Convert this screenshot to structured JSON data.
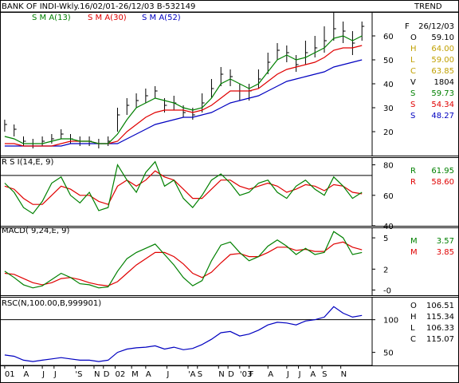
{
  "header": {
    "title": "BANK OF INDI-Wkly.16/02/01-26/12/03  B-532149",
    "trend_label": "TREND"
  },
  "colors": {
    "price": "#000000",
    "sma13": "#008000",
    "sma30": "#e00000",
    "sma52": "#0000c0",
    "panel_border": "#000000"
  },
  "chart_data": [
    {
      "type": "line",
      "panel": "price",
      "subtype": "ohlc-bars",
      "legend": [
        {
          "label": "S M A(13)",
          "color": "#008000"
        },
        {
          "label": "S M A(30)",
          "color": "#e00000"
        },
        {
          "label": "S M A(52)",
          "color": "#0000c0"
        }
      ],
      "ylim": [
        10,
        70
      ],
      "yticks": [
        "20",
        "30",
        "40",
        "50",
        "60"
      ],
      "ytick_values": [
        20,
        30,
        40,
        50,
        60
      ],
      "x": [
        0,
        4,
        8,
        12,
        16,
        20,
        24,
        28,
        32,
        36,
        40,
        44,
        48,
        52,
        56,
        60,
        64,
        68,
        72,
        76,
        80,
        84,
        88,
        92,
        96,
        100,
        104,
        108,
        112,
        116,
        120,
        124,
        128,
        132,
        136,
        140,
        144,
        148,
        152
      ],
      "close": [
        23,
        21,
        16,
        15,
        16,
        17,
        19,
        17,
        16,
        16,
        15,
        16,
        27,
        31,
        33,
        35,
        37,
        31,
        32,
        28,
        27,
        32,
        38,
        44,
        43,
        37,
        37,
        42,
        49,
        54,
        53,
        48,
        53,
        55,
        58,
        63,
        62,
        57,
        64
      ],
      "high": [
        25,
        23,
        18,
        17,
        18,
        19,
        21,
        19,
        18,
        18,
        17,
        18,
        30,
        34,
        36,
        38,
        39,
        34,
        35,
        31,
        30,
        36,
        42,
        47,
        46,
        40,
        40,
        46,
        53,
        57,
        56,
        52,
        58,
        60,
        64,
        70,
        66,
        62,
        66
      ],
      "low": [
        20,
        18,
        14,
        13,
        14,
        15,
        17,
        15,
        14,
        14,
        13,
        14,
        20,
        27,
        30,
        32,
        34,
        28,
        29,
        26,
        25,
        28,
        34,
        39,
        39,
        33,
        33,
        38,
        44,
        50,
        49,
        45,
        48,
        51,
        53,
        58,
        57,
        52,
        58
      ],
      "series": [
        {
          "name": "S M A(13)",
          "color": "#008000",
          "values": [
            18,
            17,
            15,
            15,
            15,
            16,
            17,
            17,
            16,
            16,
            15,
            15,
            19,
            25,
            30,
            32,
            34,
            33,
            32,
            30,
            29,
            30,
            34,
            40,
            42,
            40,
            38,
            40,
            45,
            50,
            52,
            50,
            51,
            53,
            55,
            59,
            60,
            58,
            60
          ]
        },
        {
          "name": "S M A(30)",
          "color": "#e00000",
          "values": [
            15,
            15,
            14,
            14,
            14,
            14,
            15,
            16,
            16,
            16,
            15,
            15,
            16,
            20,
            23,
            26,
            28,
            29,
            29,
            29,
            28,
            29,
            31,
            34,
            37,
            37,
            37,
            38,
            41,
            44,
            46,
            47,
            48,
            49,
            51,
            54,
            55,
            55,
            56
          ]
        },
        {
          "name": "S M A(52)",
          "color": "#0000c0",
          "values": [
            14,
            14,
            14,
            14,
            14,
            14,
            14,
            15,
            15,
            15,
            15,
            15,
            15,
            17,
            19,
            21,
            23,
            24,
            25,
            26,
            26,
            27,
            28,
            30,
            32,
            33,
            34,
            35,
            37,
            39,
            41,
            42,
            43,
            44,
            45,
            47,
            48,
            49,
            50
          ]
        }
      ],
      "info": [
        {
          "key": "F",
          "value": "26/12/03",
          "color": "#000000"
        },
        {
          "key": "O",
          "value": "59.10",
          "color": "#000000"
        },
        {
          "key": "H",
          "value": "64.00",
          "color": "#c0a000"
        },
        {
          "key": "L",
          "value": "59.00",
          "color": "#c0a000"
        },
        {
          "key": "C",
          "value": "63.85",
          "color": "#c0a000"
        },
        {
          "key": "V",
          "value": "1804",
          "color": "#000000"
        },
        {
          "key": "S",
          "value": "59.73",
          "color": "#008000"
        },
        {
          "key": "S",
          "value": "54.34",
          "color": "#e00000"
        },
        {
          "key": "S",
          "value": "48.27",
          "color": "#0000c0"
        }
      ]
    },
    {
      "type": "line",
      "panel": "rsi",
      "title": "R S I(14,E, 9)",
      "ylim": [
        40,
        85
      ],
      "yticks": [
        "80",
        "60",
        "40"
      ],
      "ytick_values": [
        80,
        60,
        40
      ],
      "reference_line": 73,
      "x": [
        0,
        4,
        8,
        12,
        16,
        20,
        24,
        28,
        32,
        36,
        40,
        44,
        48,
        52,
        56,
        60,
        64,
        68,
        72,
        76,
        80,
        84,
        88,
        92,
        96,
        100,
        104,
        108,
        112,
        116,
        120,
        124,
        128,
        132,
        136,
        140,
        144,
        148,
        152
      ],
      "series": [
        {
          "name": "R",
          "color": "#008000",
          "values": [
            68,
            62,
            52,
            48,
            56,
            68,
            72,
            60,
            55,
            62,
            50,
            52,
            80,
            70,
            62,
            75,
            82,
            66,
            70,
            58,
            52,
            60,
            70,
            74,
            68,
            60,
            62,
            68,
            70,
            62,
            58,
            66,
            70,
            64,
            60,
            72,
            66,
            58,
            62
          ]
        },
        {
          "name": "R",
          "color": "#e00000",
          "values": [
            66,
            64,
            58,
            54,
            54,
            60,
            66,
            64,
            60,
            60,
            56,
            54,
            66,
            70,
            66,
            70,
            76,
            72,
            70,
            64,
            58,
            58,
            64,
            70,
            70,
            66,
            64,
            66,
            68,
            66,
            62,
            64,
            67,
            66,
            63,
            67,
            66,
            62,
            61
          ]
        }
      ],
      "info": [
        {
          "key": "R",
          "value": "61.95",
          "color": "#008000"
        },
        {
          "key": "R",
          "value": "58.60",
          "color": "#e00000"
        }
      ]
    },
    {
      "type": "line",
      "panel": "macd",
      "title": "MACD( 9,24,E, 9)",
      "ylim": [
        -0.5,
        6
      ],
      "yticks": [
        "5",
        "2",
        "-0"
      ],
      "ytick_values": [
        5,
        2,
        0
      ],
      "x": [
        0,
        4,
        8,
        12,
        16,
        20,
        24,
        28,
        32,
        36,
        40,
        44,
        48,
        52,
        56,
        60,
        64,
        68,
        72,
        76,
        80,
        84,
        88,
        92,
        96,
        100,
        104,
        108,
        112,
        116,
        120,
        124,
        128,
        132,
        136,
        140,
        144,
        148,
        152
      ],
      "series": [
        {
          "name": "M",
          "color": "#008000",
          "values": [
            1.8,
            1.2,
            0.5,
            0.2,
            0.4,
            1.0,
            1.6,
            1.2,
            0.6,
            0.5,
            0.2,
            0.3,
            1.8,
            3.0,
            3.6,
            4.0,
            4.4,
            3.4,
            2.4,
            1.2,
            0.4,
            0.9,
            2.8,
            4.3,
            4.6,
            3.6,
            2.8,
            3.2,
            4.2,
            4.8,
            4.2,
            3.4,
            4.0,
            3.4,
            3.6,
            5.6,
            5.0,
            3.4,
            3.6
          ]
        },
        {
          "name": "M",
          "color": "#e00000",
          "values": [
            1.6,
            1.5,
            1.1,
            0.7,
            0.5,
            0.7,
            1.1,
            1.2,
            1.0,
            0.7,
            0.5,
            0.4,
            0.8,
            1.6,
            2.4,
            3.0,
            3.6,
            3.6,
            3.2,
            2.5,
            1.6,
            1.2,
            1.7,
            2.6,
            3.4,
            3.5,
            3.2,
            3.2,
            3.6,
            4.1,
            4.1,
            3.8,
            3.9,
            3.7,
            3.7,
            4.4,
            4.6,
            4.1,
            3.85
          ]
        }
      ],
      "info": [
        {
          "key": "M",
          "value": "3.57",
          "color": "#008000"
        },
        {
          "key": "M",
          "value": "3.85",
          "color": "#e00000"
        }
      ]
    },
    {
      "type": "line",
      "panel": "rsc",
      "title": "RSC(N,100.00,B,999901)",
      "ylim": [
        30,
        135
      ],
      "yticks": [
        "100",
        "50"
      ],
      "ytick_values": [
        100,
        50
      ],
      "reference_line": 100,
      "x": [
        0,
        4,
        8,
        12,
        16,
        20,
        24,
        28,
        32,
        36,
        40,
        44,
        48,
        52,
        56,
        60,
        64,
        68,
        72,
        76,
        80,
        84,
        88,
        92,
        96,
        100,
        104,
        108,
        112,
        116,
        120,
        124,
        128,
        132,
        136,
        140,
        144,
        148,
        152
      ],
      "series": [
        {
          "name": "RSC",
          "color": "#0000c0",
          "values": [
            46,
            44,
            38,
            36,
            38,
            40,
            42,
            40,
            38,
            38,
            36,
            38,
            50,
            55,
            57,
            58,
            60,
            55,
            58,
            54,
            56,
            62,
            70,
            80,
            82,
            75,
            78,
            84,
            92,
            96,
            95,
            92,
            98,
            100,
            104,
            120,
            110,
            104,
            106.5
          ]
        }
      ],
      "info": [
        {
          "key": "O",
          "value": "106.51",
          "color": "#000000"
        },
        {
          "key": "H",
          "value": "115.34",
          "color": "#000000"
        },
        {
          "key": "L",
          "value": "106.33",
          "color": "#000000"
        },
        {
          "key": "C",
          "value": "115.07",
          "color": "#000000"
        }
      ]
    }
  ],
  "xaxis": {
    "xlim": [
      -2,
      156
    ],
    "ticks": [
      {
        "label": "01",
        "x": 0
      },
      {
        "label": "A",
        "x": 8
      },
      {
        "label": "J",
        "x": 16
      },
      {
        "label": "J",
        "x": 21
      },
      {
        "label": "'S",
        "x": 30
      },
      {
        "label": "N",
        "x": 38
      },
      {
        "label": "D",
        "x": 42
      },
      {
        "label": "02",
        "x": 47
      },
      {
        "label": "M",
        "x": 54
      },
      {
        "label": "A",
        "x": 60
      },
      {
        "label": "J",
        "x": 69
      },
      {
        "label": "'A",
        "x": 78
      },
      {
        "label": "S",
        "x": 82
      },
      {
        "label": "N",
        "x": 91
      },
      {
        "label": "D",
        "x": 95
      },
      {
        "label": "'03",
        "x": 100
      },
      {
        "label": "F",
        "x": 104
      },
      {
        "label": "A",
        "x": 112
      },
      {
        "label": "J",
        "x": 120
      },
      {
        "label": "J",
        "x": 125
      },
      {
        "label": "A",
        "x": 130
      },
      {
        "label": "S",
        "x": 135
      },
      {
        "label": "N",
        "x": 143
      }
    ]
  }
}
